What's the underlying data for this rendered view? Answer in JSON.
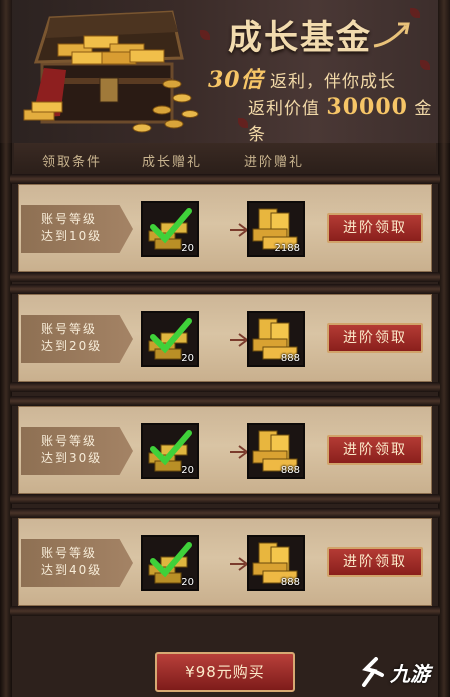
{
  "banner": {
    "title": "成长基金",
    "line1_num": "30倍",
    "line1_text": "返利，伴你成长",
    "line2_pre": "返利价值",
    "line2_num": "30000",
    "line2_post": "金条"
  },
  "table_header": {
    "col1": "领取条件",
    "col2": "成长赠礼",
    "col3": "进阶赠礼"
  },
  "rows": [
    {
      "cond_line1": "账号等级",
      "cond_line2": "达到10级",
      "growth_count": "20",
      "advanced_count": "2188",
      "button": "进阶领取"
    },
    {
      "cond_line1": "账号等级",
      "cond_line2": "达到20级",
      "growth_count": "20",
      "advanced_count": "888",
      "button": "进阶领取"
    },
    {
      "cond_line1": "账号等级",
      "cond_line2": "达到30级",
      "growth_count": "20",
      "advanced_count": "888",
      "button": "进阶领取"
    },
    {
      "cond_line1": "账号等级",
      "cond_line2": "达到40级",
      "growth_count": "20",
      "advanced_count": "888",
      "button": "进阶领取"
    }
  ],
  "buy_button": "¥98元购买",
  "watermark": "九游",
  "icons": {
    "growth": "gold-bars-checked-icon",
    "advanced": "gold-bars-icon",
    "arrow": "arrow-right-icon"
  },
  "colors": {
    "button_red": "#a02b27",
    "gold": "#f6c567",
    "panel": "#d4bf9f"
  }
}
